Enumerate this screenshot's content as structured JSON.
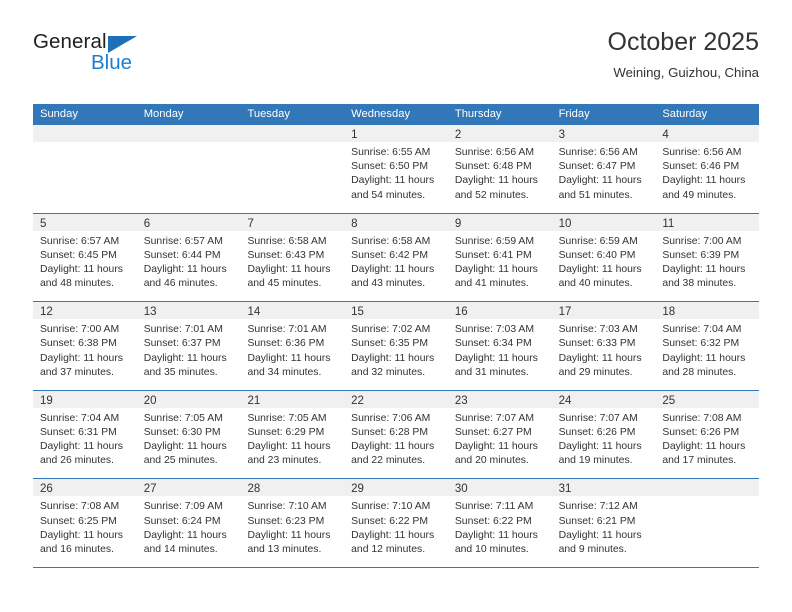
{
  "brand": {
    "name_part1": "General",
    "name_part2": "Blue",
    "triangle_color": "#1d6fb8",
    "blue_color": "#1a7fd4"
  },
  "header": {
    "title": "October 2025",
    "location": "Weining, Guizhou, China"
  },
  "colors": {
    "header_blue": "#3277b8",
    "day_number_bg": "#f0f0f0",
    "text": "#333333"
  },
  "weekdays": [
    "Sunday",
    "Monday",
    "Tuesday",
    "Wednesday",
    "Thursday",
    "Friday",
    "Saturday"
  ],
  "weeks": [
    [
      {
        "day": "",
        "sunrise": "",
        "sunset": "",
        "daylight_1": "",
        "daylight_2": ""
      },
      {
        "day": "",
        "sunrise": "",
        "sunset": "",
        "daylight_1": "",
        "daylight_2": ""
      },
      {
        "day": "",
        "sunrise": "",
        "sunset": "",
        "daylight_1": "",
        "daylight_2": ""
      },
      {
        "day": "1",
        "sunrise": "Sunrise: 6:55 AM",
        "sunset": "Sunset: 6:50 PM",
        "daylight_1": "Daylight: 11 hours",
        "daylight_2": "and 54 minutes."
      },
      {
        "day": "2",
        "sunrise": "Sunrise: 6:56 AM",
        "sunset": "Sunset: 6:48 PM",
        "daylight_1": "Daylight: 11 hours",
        "daylight_2": "and 52 minutes."
      },
      {
        "day": "3",
        "sunrise": "Sunrise: 6:56 AM",
        "sunset": "Sunset: 6:47 PM",
        "daylight_1": "Daylight: 11 hours",
        "daylight_2": "and 51 minutes."
      },
      {
        "day": "4",
        "sunrise": "Sunrise: 6:56 AM",
        "sunset": "Sunset: 6:46 PM",
        "daylight_1": "Daylight: 11 hours",
        "daylight_2": "and 49 minutes."
      }
    ],
    [
      {
        "day": "5",
        "sunrise": "Sunrise: 6:57 AM",
        "sunset": "Sunset: 6:45 PM",
        "daylight_1": "Daylight: 11 hours",
        "daylight_2": "and 48 minutes."
      },
      {
        "day": "6",
        "sunrise": "Sunrise: 6:57 AM",
        "sunset": "Sunset: 6:44 PM",
        "daylight_1": "Daylight: 11 hours",
        "daylight_2": "and 46 minutes."
      },
      {
        "day": "7",
        "sunrise": "Sunrise: 6:58 AM",
        "sunset": "Sunset: 6:43 PM",
        "daylight_1": "Daylight: 11 hours",
        "daylight_2": "and 45 minutes."
      },
      {
        "day": "8",
        "sunrise": "Sunrise: 6:58 AM",
        "sunset": "Sunset: 6:42 PM",
        "daylight_1": "Daylight: 11 hours",
        "daylight_2": "and 43 minutes."
      },
      {
        "day": "9",
        "sunrise": "Sunrise: 6:59 AM",
        "sunset": "Sunset: 6:41 PM",
        "daylight_1": "Daylight: 11 hours",
        "daylight_2": "and 41 minutes."
      },
      {
        "day": "10",
        "sunrise": "Sunrise: 6:59 AM",
        "sunset": "Sunset: 6:40 PM",
        "daylight_1": "Daylight: 11 hours",
        "daylight_2": "and 40 minutes."
      },
      {
        "day": "11",
        "sunrise": "Sunrise: 7:00 AM",
        "sunset": "Sunset: 6:39 PM",
        "daylight_1": "Daylight: 11 hours",
        "daylight_2": "and 38 minutes."
      }
    ],
    [
      {
        "day": "12",
        "sunrise": "Sunrise: 7:00 AM",
        "sunset": "Sunset: 6:38 PM",
        "daylight_1": "Daylight: 11 hours",
        "daylight_2": "and 37 minutes."
      },
      {
        "day": "13",
        "sunrise": "Sunrise: 7:01 AM",
        "sunset": "Sunset: 6:37 PM",
        "daylight_1": "Daylight: 11 hours",
        "daylight_2": "and 35 minutes."
      },
      {
        "day": "14",
        "sunrise": "Sunrise: 7:01 AM",
        "sunset": "Sunset: 6:36 PM",
        "daylight_1": "Daylight: 11 hours",
        "daylight_2": "and 34 minutes."
      },
      {
        "day": "15",
        "sunrise": "Sunrise: 7:02 AM",
        "sunset": "Sunset: 6:35 PM",
        "daylight_1": "Daylight: 11 hours",
        "daylight_2": "and 32 minutes."
      },
      {
        "day": "16",
        "sunrise": "Sunrise: 7:03 AM",
        "sunset": "Sunset: 6:34 PM",
        "daylight_1": "Daylight: 11 hours",
        "daylight_2": "and 31 minutes."
      },
      {
        "day": "17",
        "sunrise": "Sunrise: 7:03 AM",
        "sunset": "Sunset: 6:33 PM",
        "daylight_1": "Daylight: 11 hours",
        "daylight_2": "and 29 minutes."
      },
      {
        "day": "18",
        "sunrise": "Sunrise: 7:04 AM",
        "sunset": "Sunset: 6:32 PM",
        "daylight_1": "Daylight: 11 hours",
        "daylight_2": "and 28 minutes."
      }
    ],
    [
      {
        "day": "19",
        "sunrise": "Sunrise: 7:04 AM",
        "sunset": "Sunset: 6:31 PM",
        "daylight_1": "Daylight: 11 hours",
        "daylight_2": "and 26 minutes."
      },
      {
        "day": "20",
        "sunrise": "Sunrise: 7:05 AM",
        "sunset": "Sunset: 6:30 PM",
        "daylight_1": "Daylight: 11 hours",
        "daylight_2": "and 25 minutes."
      },
      {
        "day": "21",
        "sunrise": "Sunrise: 7:05 AM",
        "sunset": "Sunset: 6:29 PM",
        "daylight_1": "Daylight: 11 hours",
        "daylight_2": "and 23 minutes."
      },
      {
        "day": "22",
        "sunrise": "Sunrise: 7:06 AM",
        "sunset": "Sunset: 6:28 PM",
        "daylight_1": "Daylight: 11 hours",
        "daylight_2": "and 22 minutes."
      },
      {
        "day": "23",
        "sunrise": "Sunrise: 7:07 AM",
        "sunset": "Sunset: 6:27 PM",
        "daylight_1": "Daylight: 11 hours",
        "daylight_2": "and 20 minutes."
      },
      {
        "day": "24",
        "sunrise": "Sunrise: 7:07 AM",
        "sunset": "Sunset: 6:26 PM",
        "daylight_1": "Daylight: 11 hours",
        "daylight_2": "and 19 minutes."
      },
      {
        "day": "25",
        "sunrise": "Sunrise: 7:08 AM",
        "sunset": "Sunset: 6:26 PM",
        "daylight_1": "Daylight: 11 hours",
        "daylight_2": "and 17 minutes."
      }
    ],
    [
      {
        "day": "26",
        "sunrise": "Sunrise: 7:08 AM",
        "sunset": "Sunset: 6:25 PM",
        "daylight_1": "Daylight: 11 hours",
        "daylight_2": "and 16 minutes."
      },
      {
        "day": "27",
        "sunrise": "Sunrise: 7:09 AM",
        "sunset": "Sunset: 6:24 PM",
        "daylight_1": "Daylight: 11 hours",
        "daylight_2": "and 14 minutes."
      },
      {
        "day": "28",
        "sunrise": "Sunrise: 7:10 AM",
        "sunset": "Sunset: 6:23 PM",
        "daylight_1": "Daylight: 11 hours",
        "daylight_2": "and 13 minutes."
      },
      {
        "day": "29",
        "sunrise": "Sunrise: 7:10 AM",
        "sunset": "Sunset: 6:22 PM",
        "daylight_1": "Daylight: 11 hours",
        "daylight_2": "and 12 minutes."
      },
      {
        "day": "30",
        "sunrise": "Sunrise: 7:11 AM",
        "sunset": "Sunset: 6:22 PM",
        "daylight_1": "Daylight: 11 hours",
        "daylight_2": "and 10 minutes."
      },
      {
        "day": "31",
        "sunrise": "Sunrise: 7:12 AM",
        "sunset": "Sunset: 6:21 PM",
        "daylight_1": "Daylight: 11 hours",
        "daylight_2": "and 9 minutes."
      },
      {
        "day": "",
        "sunrise": "",
        "sunset": "",
        "daylight_1": "",
        "daylight_2": ""
      }
    ]
  ]
}
